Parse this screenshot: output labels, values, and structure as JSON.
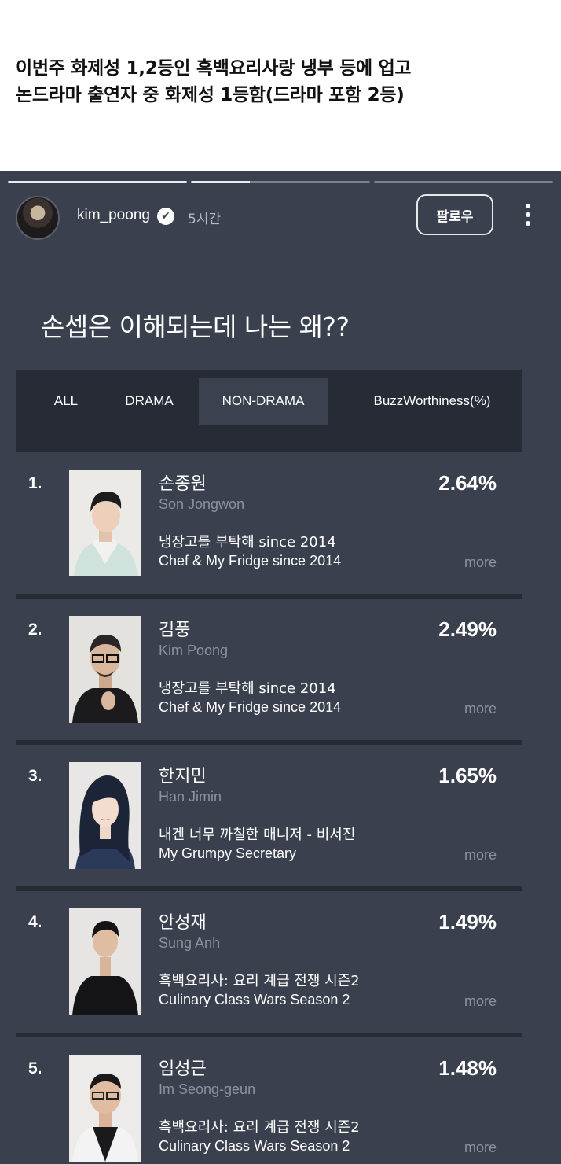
{
  "caption": {
    "line1": "이번주 화제성 1,2등인 흑백요리사랑 냉부 등에 업고",
    "line2": "논드라마 출연자 중 화제성 1등함(드라마 포함 2등)"
  },
  "story": {
    "progress": [
      1.0,
      0.33,
      0.0
    ],
    "username": "kim_poong",
    "verified_icon": "✔",
    "time": "5시간",
    "follow_label": "팔로우",
    "text": "손셉은 이해되는데 나는 왜??"
  },
  "ranking": {
    "tabs": [
      {
        "label": "ALL",
        "active": false
      },
      {
        "label": "DRAMA",
        "active": false
      },
      {
        "label": "NON-DRAMA",
        "active": true
      },
      {
        "label": "BuzzWorthiness(%)",
        "active": false
      }
    ],
    "items": [
      {
        "rank": "1.",
        "name_ko": "손종원",
        "name_en": "Son Jongwon",
        "show_ko": "냉장고를 부탁해 since 2014",
        "show_en": "Chef & My Fridge since 2014",
        "value": "2.64%",
        "more": "more"
      },
      {
        "rank": "2.",
        "name_ko": "김풍",
        "name_en": "Kim Poong",
        "show_ko": "냉장고를 부탁해 since 2014",
        "show_en": "Chef & My Fridge since 2014",
        "value": "2.49%",
        "more": "more"
      },
      {
        "rank": "3.",
        "name_ko": "한지민",
        "name_en": "Han Jimin",
        "show_ko": "내겐 너무 까칠한 매니저 - 비서진",
        "show_en": "My Grumpy Secretary",
        "value": "1.65%",
        "more": "more"
      },
      {
        "rank": "4.",
        "name_ko": "안성재",
        "name_en": "Sung Anh",
        "show_ko": "흑백요리사: 요리 계급 전쟁 시즌2",
        "show_en": "Culinary Class Wars Season 2",
        "value": "1.49%",
        "more": "more"
      },
      {
        "rank": "5.",
        "name_ko": "임성근",
        "name_en": "Im Seong-geun",
        "show_ko": "흑백요리사: 요리 계급 전쟁 시즌2",
        "show_en": "Culinary Class Wars Season 2",
        "value": "1.48%",
        "more": "more"
      }
    ]
  }
}
